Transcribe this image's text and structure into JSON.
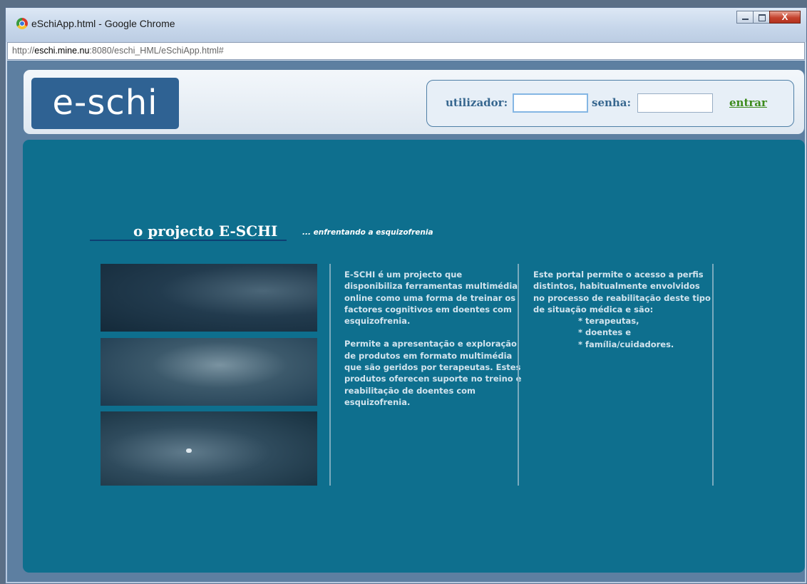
{
  "window": {
    "title": "eSchiApp.html - Google Chrome",
    "close_label": "X"
  },
  "address": {
    "prefix": "http://",
    "host": "eschi.mine.nu",
    "rest": ":8080/eschi_HML/eSchiApp.html#"
  },
  "header": {
    "logo": "e-schi",
    "login": {
      "user_label": "utilizador:",
      "user_value": "",
      "pass_label": "senha:",
      "pass_value": "",
      "submit_label": "entrar"
    }
  },
  "main": {
    "title": "o projecto E-SCHI",
    "subtitle": "... enfrentando a esquizofrenia",
    "col1": {
      "para1": "E-SCHI é um projecto que disponibiliza ferramentas multimédia online como uma forma de treinar os factores cognitivos em doentes com esquizofrenia.",
      "para2": "Permite a apresentação e exploração de produtos em formato multimédia que são geridos por terapeutas. Estes produtos oferecen suporte no treino e reabilitação de doentes com esquizofrenia."
    },
    "col2": {
      "intro": "Este portal permite o acesso a perfis distintos, habitualmente envolvidos no processo de reabilitação deste tipo de situação médica e são:",
      "items": [
        "* terapeutas,",
        "* doentes e",
        "* família/cuidadores."
      ]
    }
  }
}
